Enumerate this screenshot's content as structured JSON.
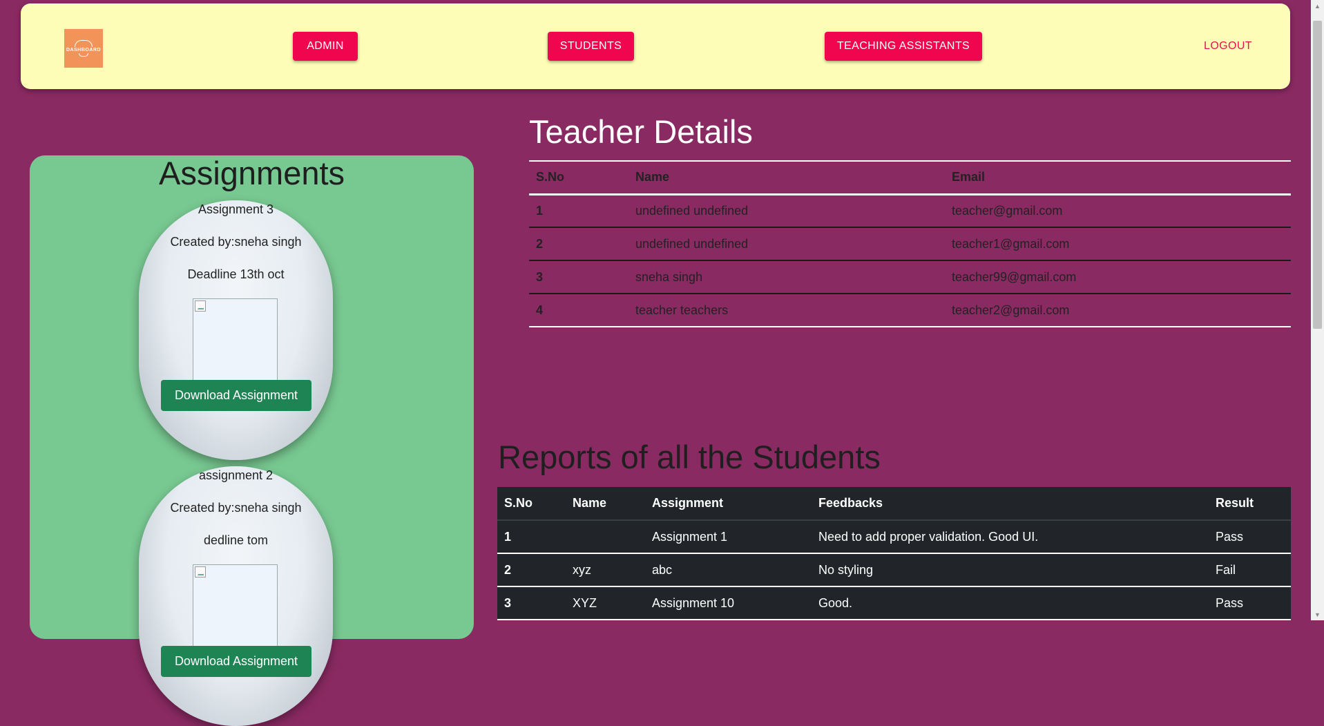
{
  "navbar": {
    "logo_text": "DASHBOARD",
    "buttons": [
      {
        "label": "ADMIN"
      },
      {
        "label": "STUDENTS"
      },
      {
        "label": "TEACHING ASSISTANTS"
      }
    ],
    "logout_label": "LOGOUT"
  },
  "assignments": {
    "title": "Assignments",
    "cards": [
      {
        "name": "Assignment 3",
        "created_by": "Created by:sneha singh",
        "deadline": "Deadline 13th oct",
        "button_label": "Download Assignment"
      },
      {
        "name": "assignment 2",
        "created_by": "Created by:sneha singh",
        "deadline": "dedline tom",
        "button_label": "Download Assignment"
      }
    ]
  },
  "teacher_details": {
    "title": "Teacher Details",
    "columns": [
      "S.No",
      "Name",
      "Email"
    ],
    "rows": [
      [
        "1",
        "undefined undefined",
        "teacher@gmail.com"
      ],
      [
        "2",
        "undefined undefined",
        "teacher1@gmail.com"
      ],
      [
        "3",
        "sneha singh",
        "teacher99@gmail.com"
      ],
      [
        "4",
        "teacher teachers",
        "teacher2@gmail.com"
      ]
    ]
  },
  "reports": {
    "title": "Reports of all the Students",
    "columns": [
      "S.No",
      "Name",
      "Assignment",
      "Feedbacks",
      "Result"
    ],
    "rows": [
      [
        "1",
        "",
        "Assignment 1",
        "Need to add proper validation. Good UI.",
        "Pass"
      ],
      [
        "2",
        "xyz",
        "abc",
        "No styling",
        "Fail"
      ],
      [
        "3",
        "XYZ",
        "Assignment 10",
        "Good.",
        "Pass"
      ]
    ]
  },
  "colors": {
    "page_bg": "#8a2a62",
    "navbar_bg": "#fdfdb8",
    "nav_button": "#f0064e",
    "assign_panel": "#78c891",
    "download_button": "#1e8454",
    "reports_table_bg": "#212529"
  }
}
